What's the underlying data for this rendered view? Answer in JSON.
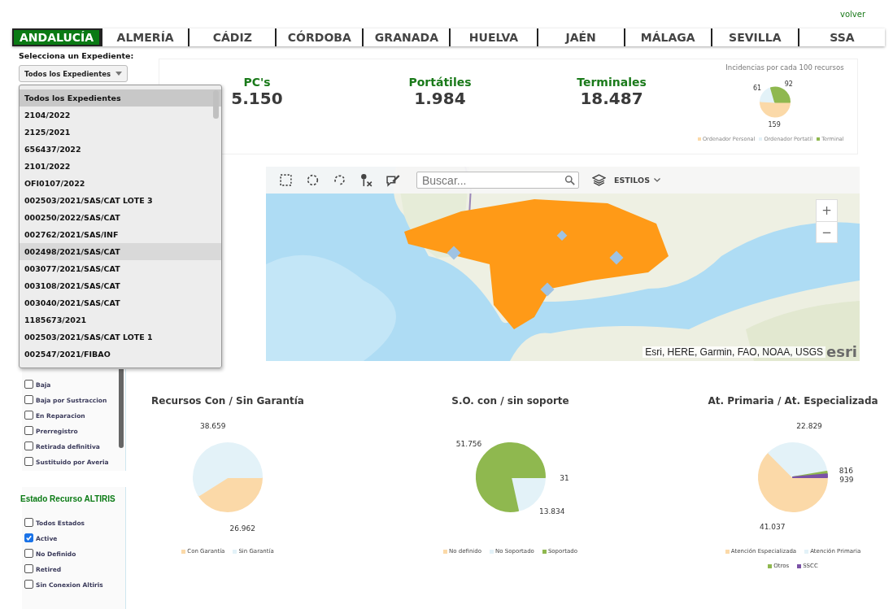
{
  "header": {
    "link": "volver"
  },
  "tabs": [
    {
      "label": "ANDALUCÍA",
      "selected": true
    },
    {
      "label": "ALMERÍA",
      "selected": false
    },
    {
      "label": "CÁDIZ",
      "selected": false
    },
    {
      "label": "CÓRDOBA",
      "selected": false
    },
    {
      "label": "GRANADA",
      "selected": false
    },
    {
      "label": "HUELVA",
      "selected": false
    },
    {
      "label": "JAÉN",
      "selected": false
    },
    {
      "label": "MÁLAGA",
      "selected": false
    },
    {
      "label": "SEVILLA",
      "selected": false
    },
    {
      "label": "SSA",
      "selected": false
    }
  ],
  "sidebar": {
    "select_label": "Selecciona un Expediente:",
    "select": {
      "value": "Todos los Expedientes"
    },
    "dropdown": {
      "items": [
        {
          "label": "Todos los Expedientes",
          "selected": true,
          "hovered": false
        },
        {
          "label": "2104/2022",
          "selected": false,
          "hovered": false
        },
        {
          "label": "2125/2021",
          "selected": false,
          "hovered": false
        },
        {
          "label": "656437/2022",
          "selected": false,
          "hovered": false
        },
        {
          "label": "2101/2022",
          "selected": false,
          "hovered": false
        },
        {
          "label": "OFI0107/2022",
          "selected": false,
          "hovered": false
        },
        {
          "label": "002503/2021/SAS/CAT LOTE 3",
          "selected": false,
          "hovered": false
        },
        {
          "label": "000250/2022/SAS/CAT",
          "selected": false,
          "hovered": false
        },
        {
          "label": "002762/2021/SAS/INF",
          "selected": false,
          "hovered": false
        },
        {
          "label": "002498/2021/SAS/CAT",
          "selected": false,
          "hovered": true
        },
        {
          "label": "003077/2021/SAS/CAT",
          "selected": false,
          "hovered": false
        },
        {
          "label": "003108/2021/SAS/CAT",
          "selected": false,
          "hovered": false
        },
        {
          "label": "003040/2021/SAS/CAT",
          "selected": false,
          "hovered": false
        },
        {
          "label": "1185673/2021",
          "selected": false,
          "hovered": false
        },
        {
          "label": "002503/2021/SAS/CAT LOTE 1",
          "selected": false,
          "hovered": false
        },
        {
          "label": "002547/2021/FIBAO",
          "selected": false,
          "hovered": false
        }
      ]
    },
    "estado_cms": {
      "items": [
        {
          "label": "Baja",
          "checked": false
        },
        {
          "label": "Baja por Sustraccion",
          "checked": false
        },
        {
          "label": "En Reparacion",
          "checked": false
        },
        {
          "label": "Prerregistro",
          "checked": false
        },
        {
          "label": "Retirada definitiva",
          "checked": false
        },
        {
          "label": "Sustituido por Averia",
          "checked": false
        }
      ]
    },
    "estado_altiris": {
      "title": "Estado Recurso ALTIRIS",
      "items": [
        {
          "label": "Todos Estados",
          "checked": false
        },
        {
          "label": "Active",
          "checked": true
        },
        {
          "label": "No Definido",
          "checked": false
        },
        {
          "label": "Retired",
          "checked": false
        },
        {
          "label": "Sin Conexion Altiris",
          "checked": false
        }
      ]
    }
  },
  "stats": [
    {
      "label": "PC's",
      "value": "5.150"
    },
    {
      "label": "Portátiles",
      "value": "1.984"
    },
    {
      "label": "Terminales",
      "value": "18.487"
    }
  ],
  "incidencias": {
    "chart_data": {
      "type": "pie",
      "title": "Incidencias por cada 100 recursos",
      "categories": [
        "Ordenador Personal",
        "Ordenador Portatil",
        "Terminal"
      ],
      "values": [
        159,
        61,
        92
      ],
      "colors": [
        "#fbd9a8",
        "#e3f2f8",
        "#8fb84f"
      ],
      "data_labels": true,
      "value_labels": [
        "159",
        "61",
        "92"
      ]
    }
  },
  "map": {
    "search": {
      "placeholder": "Buscar..."
    },
    "styles_button": "ESTILOS",
    "zoom_in": "+",
    "zoom_out": "−",
    "attribution": "Esri, HERE, Garmin, FAO, NOAA, USGS",
    "logo": "esri"
  },
  "charts": [
    {
      "chart_data": {
        "type": "pie",
        "title": "Recursos Con / Sin Garantía",
        "categories": [
          "Con Garantía",
          "Sin Garantía"
        ],
        "values": [
          26962,
          38659
        ],
        "colors": [
          "#fbd9a8",
          "#e3f2f8"
        ],
        "data_labels": true,
        "value_labels": [
          "26.962",
          "38.659"
        ]
      }
    },
    {
      "chart_data": {
        "type": "pie",
        "title": "S.O. con / sin soporte",
        "categories": [
          "No definido",
          "No Soportado",
          "Soportado"
        ],
        "values": [
          31,
          13834,
          51756
        ],
        "colors": [
          "#fbd9a8",
          "#e3f2f8",
          "#8fb84f"
        ],
        "data_labels": true,
        "value_labels": [
          "31",
          "13.834",
          "51.756"
        ]
      }
    },
    {
      "chart_data": {
        "type": "pie",
        "title": "At. Primaria / At. Especializada",
        "categories": [
          "Atención Especializada",
          "Atención Primaria",
          "Otros",
          "SSCC"
        ],
        "values": [
          41037,
          22829,
          816,
          939
        ],
        "colors": [
          "#fbd9a8",
          "#e3f2f8",
          "#8fb84f",
          "#7b52a6"
        ],
        "data_labels": true,
        "value_labels": [
          "41.037",
          "22.829",
          "816",
          "939"
        ]
      }
    }
  ]
}
